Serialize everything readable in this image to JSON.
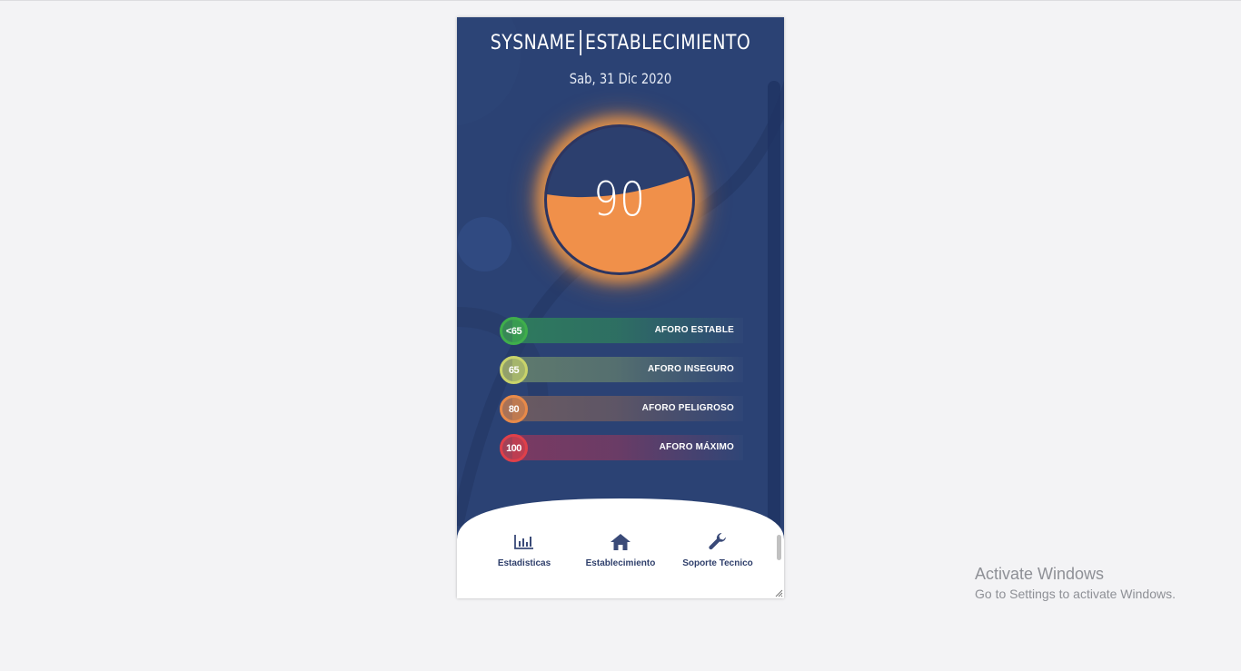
{
  "app": {
    "brand": "SYSNAME",
    "section": "ESTABLECIMIENTO",
    "date": "Sab, 31 Dic 2020"
  },
  "gauge": {
    "value": "90",
    "fill_fraction": 0.6,
    "fill_color": "#f0904a",
    "glow_color": "#ffa046"
  },
  "levels": [
    {
      "badge": "<65",
      "label": "AFORO ESTABLE",
      "color": "#3fae4b",
      "bar_color": "#2e7a5e"
    },
    {
      "badge": "65",
      "label": "AFORO INSEGURO",
      "color": "#c9d36a",
      "bar_color": "#5f7a6e"
    },
    {
      "badge": "80",
      "label": "AFORO PELIGROSO",
      "color": "#e88a49",
      "bar_color": "#6a5a62"
    },
    {
      "badge": "100",
      "label": "AFORO MÁXIMO",
      "color": "#e0404a",
      "bar_color": "#7a3a62"
    }
  ],
  "nav": [
    {
      "icon": "bar-chart-icon",
      "label": "Estadisticas"
    },
    {
      "icon": "home-icon",
      "label": "Establecimiento"
    },
    {
      "icon": "wrench-icon",
      "label": "Soporte Tecnico"
    }
  ],
  "watermark": {
    "title": "Activate Windows",
    "subtitle": "Go to Settings to activate Windows."
  },
  "colors": {
    "page_bg": "#f3f3f5",
    "app_bg": "#2b4274",
    "nav_text": "#2f3f6b"
  }
}
